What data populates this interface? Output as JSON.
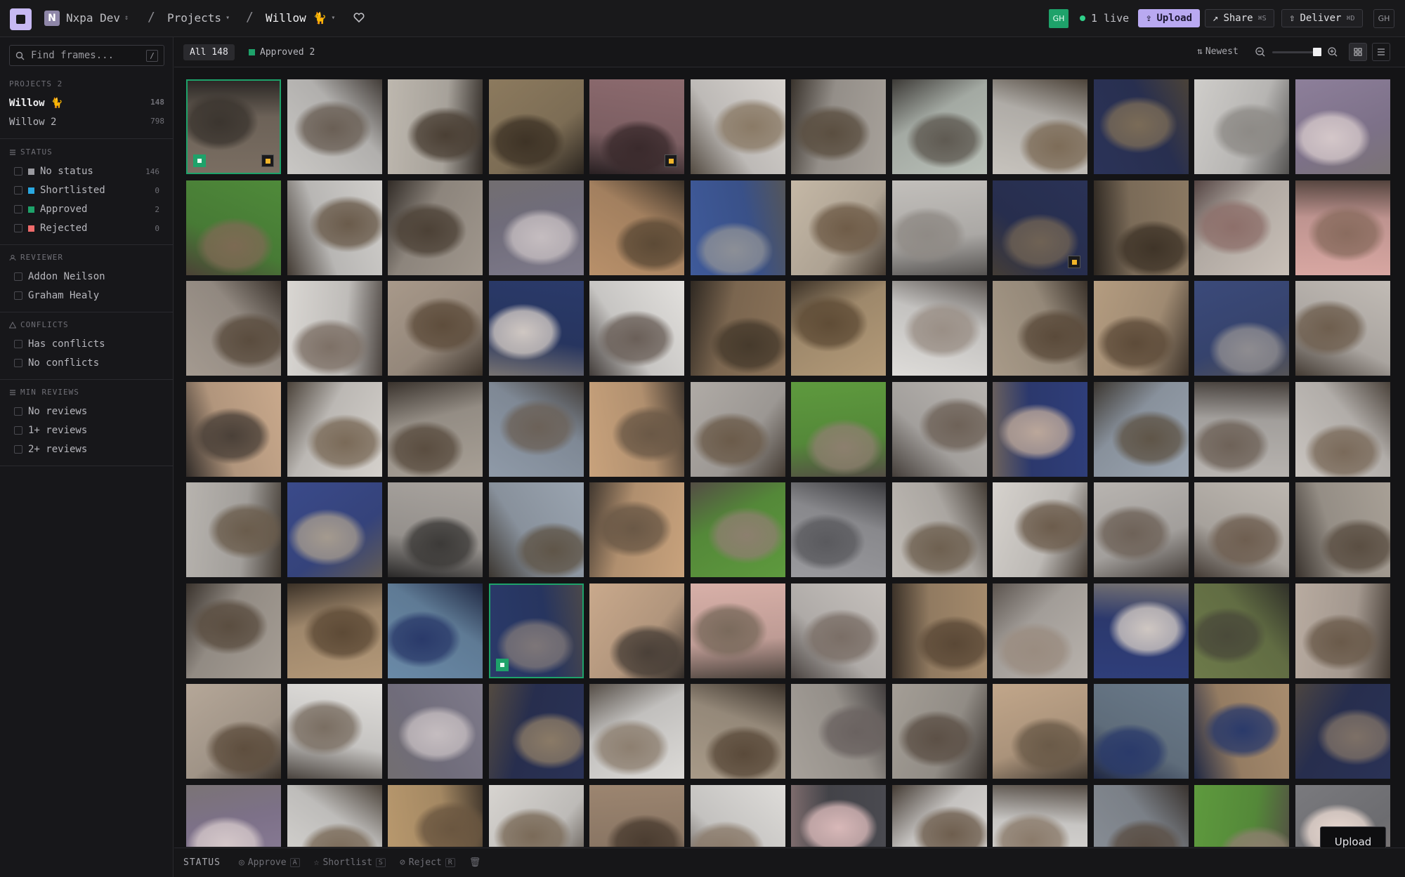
{
  "header": {
    "workspace_initial": "N",
    "workspace": "Nxpa Dev",
    "projects_label": "Projects",
    "project": "Willow 🐈",
    "user_badge": "GH",
    "live_label": "1 live",
    "upload_label": "Upload",
    "share_label": "Share",
    "share_kbd": "⌘S",
    "deliver_label": "Deliver",
    "deliver_kbd": "⌘D",
    "account_badge": "GH",
    "brand_color": "#b9a9f1"
  },
  "sidebar": {
    "search_placeholder": "Find frames...",
    "search_shortcut": "/",
    "projects_title": "PROJECTS 2",
    "projects": [
      {
        "name": "Willow 🐈",
        "count": "148"
      },
      {
        "name": "Willow 2",
        "count": "798"
      }
    ],
    "status_title": "STATUS",
    "status": [
      {
        "label": "No status",
        "count": "146",
        "color": "#9a9aa0"
      },
      {
        "label": "Shortlisted",
        "count": "0",
        "color": "#2aa8e0"
      },
      {
        "label": "Approved",
        "count": "2",
        "color": "#1ea26a"
      },
      {
        "label": "Rejected",
        "count": "0",
        "color": "#ef6b6b"
      }
    ],
    "reviewer_title": "REVIEWER",
    "reviewers": [
      {
        "label": "Addon Neilson"
      },
      {
        "label": "Graham Healy"
      }
    ],
    "conflicts_title": "CONFLICTS",
    "conflicts": [
      {
        "label": "Has conflicts"
      },
      {
        "label": "No conflicts"
      }
    ],
    "min_reviews_title": "MIN REVIEWS",
    "min_reviews": [
      {
        "label": "No reviews"
      },
      {
        "label": "1+ reviews"
      },
      {
        "label": "2+ reviews"
      }
    ]
  },
  "filters": {
    "all_label": "All 148",
    "approved_label": "Approved 2",
    "sort_label": "Newest"
  },
  "floating": {
    "upload_label": "Upload"
  },
  "bottom": {
    "status_label": "STATUS",
    "approve_label": "Approve",
    "approve_key": "A",
    "shortlist_label": "Shortlist",
    "shortlist_key": "S",
    "reject_label": "Reject",
    "reject_key": "R"
  },
  "gallery": {
    "columns": 12,
    "approved_tiles": [
      0,
      63
    ],
    "flagged_tiles": [
      0,
      4,
      20,
      87
    ],
    "palette": [
      [
        "#7a6e62",
        "#3b352f"
      ],
      [
        "#c9c7c4",
        "#6a5f55"
      ],
      [
        "#bdb7ae",
        "#4a3f34"
      ],
      [
        "#8c7a5e",
        "#3e3326"
      ],
      [
        "#8c6a6e",
        "#3a2a2c"
      ],
      [
        "#d7d3cf",
        "#8a7a66"
      ],
      [
        "#a7a19a",
        "#5a4e40"
      ],
      [
        "#b9c0b8",
        "#5f5a52"
      ],
      [
        "#c7c3bd",
        "#7d6c58"
      ],
      [
        "#2b3358",
        "#7a6b57"
      ],
      [
        "#cfcdca",
        "#8d8a86"
      ],
      [
        "#8d7f9a",
        "#d4c7c9"
      ],
      [
        "#4f8a3a",
        "#7c6a53"
      ],
      [
        "#d1cfcc",
        "#6a5b4b"
      ],
      [
        "#9f968c",
        "#4c4136"
      ],
      [
        "#7e7a8a",
        "#c5bdc0"
      ],
      [
        "#b8906a",
        "#5c4a36"
      ],
      [
        "#3f5a9a",
        "#8c8f96"
      ],
      [
        "#c5b8a6",
        "#6f5c48"
      ],
      [
        "#c2bfbb",
        "#8f8a85"
      ],
      [
        "#2a3256",
        "#6f6254"
      ],
      [
        "#8a7862",
        "#3f3428"
      ],
      [
        "#c9c0b8",
        "#8d6f6a"
      ],
      [
        "#d8a7a2",
        "#8a6c5f"
      ],
      [
        "#a49a90",
        "#5a4c3e"
      ],
      [
        "#d9d6d2",
        "#7d7066"
      ],
      [
        "#a8998a",
        "#5e4d3c"
      ],
      [
        "#2a3a6a",
        "#cfc7c2"
      ],
      [
        "#e2e0dd",
        "#6a5f58"
      ],
      [
        "#8a7258",
        "#463a2c"
      ],
      [
        "#b39a78",
        "#5f4c36"
      ],
      [
        "#dedcd9",
        "#9a8f86"
      ],
      [
        "#a89a88",
        "#5a4a3a"
      ],
      [
        "#b49c80",
        "#5d4b39"
      ],
      [
        "#3b4a7a",
        "#8e8c90"
      ],
      [
        "#c1bbb5",
        "#6e5e4e"
      ],
      [
        "#c9a98c",
        "#4a4038"
      ],
      [
        "#d5d1cc",
        "#7a6a58"
      ],
      [
        "#a79f95",
        "#5a4d40"
      ],
      [
        "#8f9aa8",
        "#6b6158"
      ],
      [
        "#c8a27c",
        "#6a5846"
      ],
      [
        "#b0aba6",
        "#6b5b4a"
      ],
      [
        "#5e9a3e",
        "#8c7f6e"
      ],
      [
        "#b8b4b0",
        "#6e6258"
      ],
      [
        "#2f3e7a",
        "#bba79a"
      ],
      [
        "#9aa4b0",
        "#5f5548"
      ],
      [
        "#b8b4b0",
        "#6e6258"
      ],
      [
        "#c9c4bf",
        "#7a6a5a"
      ],
      [
        "#b7b3ae",
        "#6a5c4c"
      ],
      [
        "#3a4a8a",
        "#a49a8e"
      ],
      [
        "#a8a39e",
        "#3c3a38"
      ],
      [
        "#9aa4b0",
        "#5f5548"
      ],
      [
        "#c8a27c",
        "#6a5846"
      ],
      [
        "#5e9a3e",
        "#8c7f6e"
      ],
      [
        "#9a9a9e",
        "#5a5a5e"
      ],
      [
        "#c1bcb6",
        "#6e6050"
      ],
      [
        "#d6d2cd",
        "#6c5c4c"
      ],
      [
        "#b8b4b0",
        "#6e6258"
      ],
      [
        "#bdb7b0",
        "#6e5e50"
      ],
      [
        "#a8a096",
        "#5a4e42"
      ],
      [
        "#a59d94",
        "#5a4d40"
      ],
      [
        "#b39878",
        "#5d4a36"
      ],
      [
        "#6a8aa8",
        "#2a3a6a"
      ],
      [
        "#2a3a6a",
        "#7d7678"
      ],
      [
        "#c9a98c",
        "#4a4038"
      ],
      [
        "#d8b0a8",
        "#7a6a5c"
      ],
      [
        "#c6c1bd",
        "#7a6e66"
      ],
      [
        "#a48a6c",
        "#5a4836"
      ],
      [
        "#b8b2ac",
        "#9a8c80"
      ],
      [
        "#2f3e7a",
        "#cfc7c2"
      ],
      [
        "#6d7a4a",
        "#4a4a3a"
      ],
      [
        "#b8aba0",
        "#6a5a4a"
      ],
      [
        "#b5a798",
        "#5e4e3e"
      ],
      [
        "#e0dedb",
        "#7a6e62"
      ],
      [
        "#7e7a8a",
        "#c5bdc0"
      ],
      [
        "#2a3256",
        "#8a7a66"
      ],
      [
        "#dcdad7",
        "#8d7f70"
      ],
      [
        "#a89a88",
        "#5a4a3a"
      ],
      [
        "#a7a19a",
        "#6a6260"
      ],
      [
        "#a49e96",
        "#5c5046"
      ],
      [
        "#c1a68a",
        "#6a5a48"
      ],
      [
        "#6a7a8a",
        "#2a3a6a"
      ],
      [
        "#a88c6e",
        "#2a3a6a"
      ],
      [
        "#2a3256",
        "#7d7066"
      ],
      [
        "#8d7f9a",
        "#d4c7c9"
      ],
      [
        "#d8d6d3",
        "#7a6a58"
      ],
      [
        "#b9996e",
        "#6a5640"
      ],
      [
        "#d7d4d0",
        "#7a6a58"
      ],
      [
        "#9c8570",
        "#4a3c30"
      ],
      [
        "#dedcd9",
        "#8a7a6a"
      ],
      [
        "#4a4a50",
        "#d8b8b8"
      ],
      [
        "#e0ddda",
        "#6e5e4e"
      ],
      [
        "#e2e0dd",
        "#8a7a6a"
      ],
      [
        "#8a9098",
        "#5a4e44"
      ],
      [
        "#5e9a3e",
        "#8c7f6e"
      ],
      [
        "#7a7a7e",
        "#e8d8d0"
      ]
    ]
  }
}
